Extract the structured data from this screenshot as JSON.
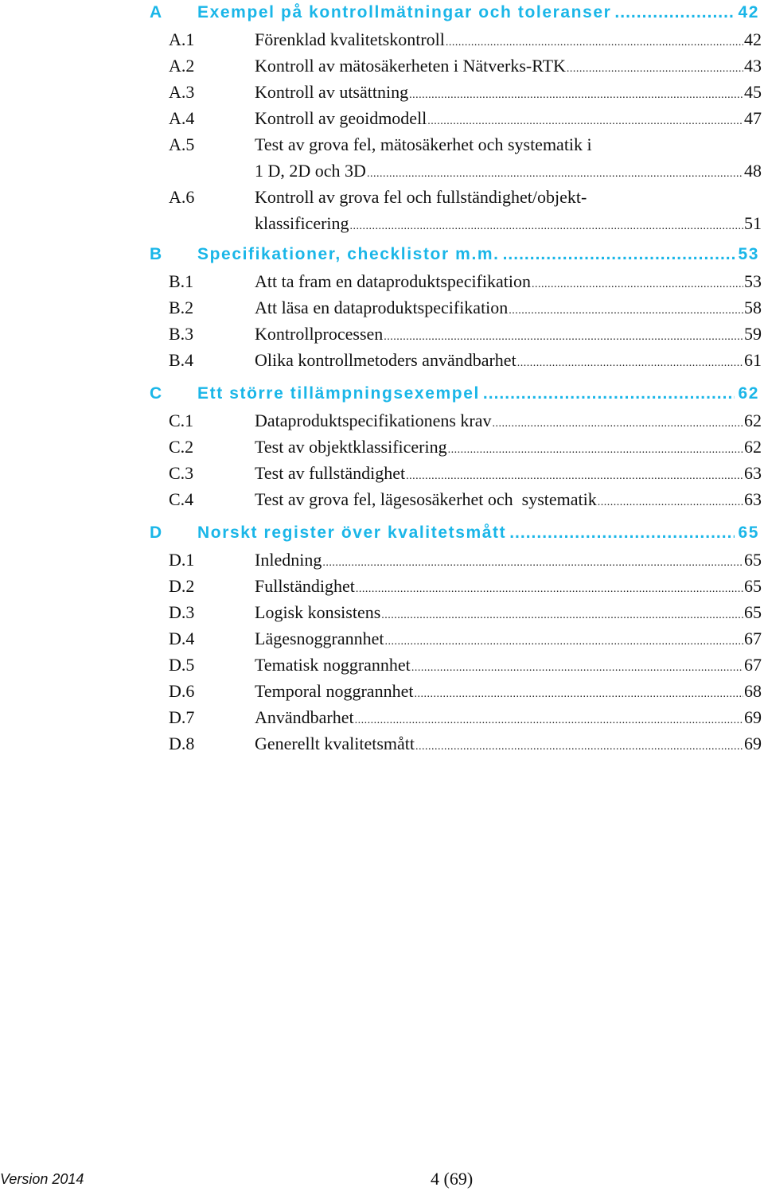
{
  "sections": [
    {
      "letter": "A",
      "title": "Exempel på kontrollmätningar och toleranser",
      "page": "42",
      "entries": [
        {
          "num": "A.1",
          "title": "Förenklad kvalitetskontroll",
          "page": "42"
        },
        {
          "num": "A.2",
          "title": "Kontroll av mätosäkerheten i Nätverks-RTK",
          "page": "43"
        },
        {
          "num": "A.3",
          "title": "Kontroll av utsättning",
          "page": "45"
        },
        {
          "num": "A.4",
          "title": "Kontroll av geoidmodell",
          "page": "47"
        },
        {
          "num": "A.5",
          "title_line1": "Test av grova fel, mätosäkerhet och systematik i",
          "title": "1 D, 2D och 3D",
          "page": "48"
        },
        {
          "num": "A.6",
          "title_line1": "Kontroll av grova fel och fullständighet/objekt-",
          "title": "klassificering",
          "page": "51"
        }
      ]
    },
    {
      "letter": "B",
      "title": "Specifikationer, checklistor m.m.",
      "page": "53",
      "entries": [
        {
          "num": "B.1",
          "title": "Att ta fram en dataproduktspecifikation",
          "page": "53"
        },
        {
          "num": "B.2",
          "title": "Att läsa en dataproduktspecifikation",
          "page": "58"
        },
        {
          "num": "B.3",
          "title": "Kontrollprocessen",
          "page": "59"
        },
        {
          "num": "B.4",
          "title": "Olika kontrollmetoders användbarhet",
          "page": "61"
        }
      ]
    },
    {
      "letter": "C",
      "title": "Ett större tillämpningsexempel",
      "page": "62",
      "entries": [
        {
          "num": "C.1",
          "title": "Dataproduktspecifikationens krav",
          "page": "62"
        },
        {
          "num": "C.2",
          "title": "Test av objektklassificering",
          "page": "62"
        },
        {
          "num": "C.3",
          "title": "Test av fullständighet",
          "page": "63"
        },
        {
          "num": "C.4",
          "title": "Test av grova fel, lägesosäkerhet och  systematik",
          "page": "63"
        }
      ]
    },
    {
      "letter": "D",
      "title": "Norskt register över kvalitetsmått",
      "page": "65",
      "entries": [
        {
          "num": "D.1",
          "title": "Inledning",
          "page": "65"
        },
        {
          "num": "D.2",
          "title": "Fullständighet",
          "page": "65"
        },
        {
          "num": "D.3",
          "title": "Logisk konsistens",
          "page": "65"
        },
        {
          "num": "D.4",
          "title": "Lägesnoggrannhet",
          "page": "67"
        },
        {
          "num": "D.5",
          "title": "Tematisk noggrannhet",
          "page": "67"
        },
        {
          "num": "D.6",
          "title": "Temporal noggrannhet",
          "page": "68"
        },
        {
          "num": "D.7",
          "title": "Användbarhet",
          "page": "69"
        },
        {
          "num": "D.8",
          "title": "Generellt kvalitetsmått",
          "page": "69"
        }
      ]
    }
  ],
  "footer": {
    "version": "Version 2014",
    "page_number": "4 (69)"
  }
}
